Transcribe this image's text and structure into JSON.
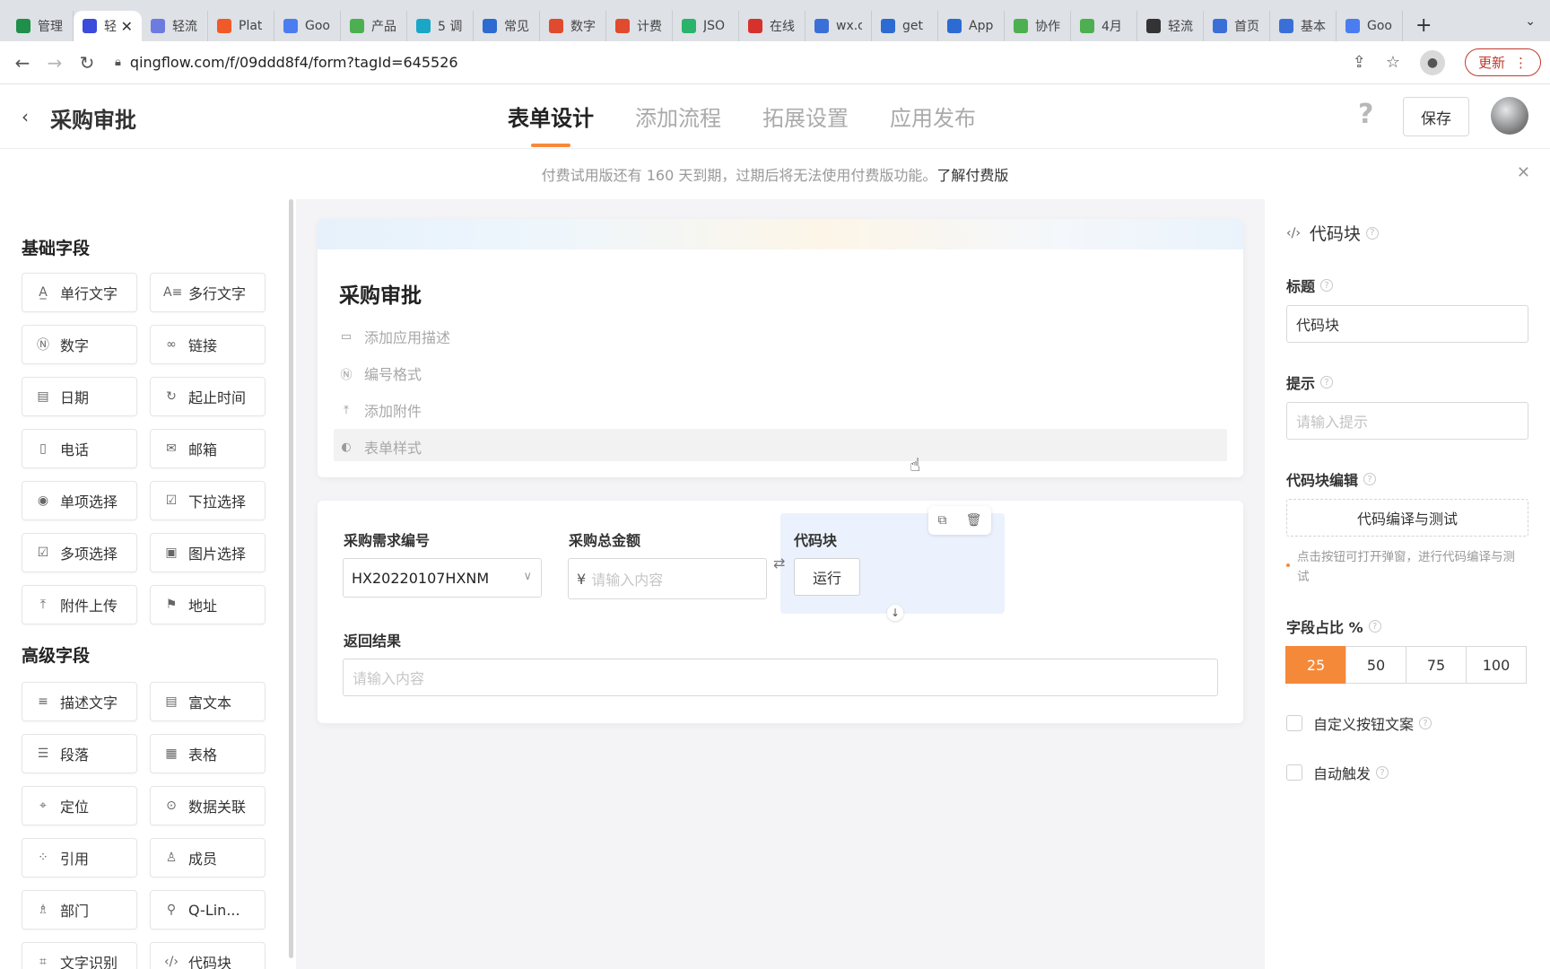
{
  "browser": {
    "tabs": [
      {
        "label": "管理",
        "color": "#1f8f4a"
      },
      {
        "label": "轻",
        "color": "#3b4bdb",
        "active": true
      },
      {
        "label": "轻流",
        "color": "#6b7be0"
      },
      {
        "label": "Plat",
        "color": "#f05a28"
      },
      {
        "label": "Goo",
        "color": "#4a7ef0"
      },
      {
        "label": "产品",
        "color": "#4caf50"
      },
      {
        "label": "5 调",
        "color": "#1aa7c7"
      },
      {
        "label": "常见",
        "color": "#2c6bd1"
      },
      {
        "label": "数字",
        "color": "#e04a2f"
      },
      {
        "label": "计费",
        "color": "#e04a2f"
      },
      {
        "label": "JSO",
        "color": "#29b36b"
      },
      {
        "label": "在线",
        "color": "#d6322b"
      },
      {
        "label": "wx.c",
        "color": "#3a6fd8"
      },
      {
        "label": "get",
        "color": "#2c6bd1"
      },
      {
        "label": "App",
        "color": "#2c6bd1"
      },
      {
        "label": "协作",
        "color": "#4caf50"
      },
      {
        "label": "4月",
        "color": "#4caf50"
      },
      {
        "label": "轻流",
        "color": "#333333"
      },
      {
        "label": "首页",
        "color": "#3a6fd8"
      },
      {
        "label": "基本",
        "color": "#3a6fd8"
      },
      {
        "label": "Goo",
        "color": "#4a7ef0"
      }
    ],
    "active_close": "✕",
    "new_tab": "+",
    "tab_menu": "⌄",
    "url": "qingflow.com/f/09ddd8f4/form?tagId=645526",
    "update_label": "更新",
    "update_menu": "⋮"
  },
  "header": {
    "back": "‹",
    "title": "采购审批",
    "tabs": [
      "表单设计",
      "添加流程",
      "拓展设置",
      "应用发布"
    ],
    "active_tab": 0,
    "help": "?",
    "save_label": "保存"
  },
  "notice": {
    "text": "付费试用版还有 160 天到期，过期后将无法使用付费版功能。",
    "link": "了解付费版",
    "close": "✕"
  },
  "left_panel": {
    "basic_title": "基础字段",
    "basic_fields": [
      {
        "label": "单行文字",
        "icon": "A̲"
      },
      {
        "label": "多行文字",
        "icon": "A≡"
      },
      {
        "label": "数字",
        "icon": "Ⓝ"
      },
      {
        "label": "链接",
        "icon": "∞"
      },
      {
        "label": "日期",
        "icon": "▤"
      },
      {
        "label": "起止时间",
        "icon": "↻"
      },
      {
        "label": "电话",
        "icon": "▯"
      },
      {
        "label": "邮箱",
        "icon": "✉"
      },
      {
        "label": "单项选择",
        "icon": "◉"
      },
      {
        "label": "下拉选择",
        "icon": "☑"
      },
      {
        "label": "多项选择",
        "icon": "☑"
      },
      {
        "label": "图片选择",
        "icon": "▣"
      },
      {
        "label": "附件上传",
        "icon": "⤒"
      },
      {
        "label": "地址",
        "icon": "⚑"
      }
    ],
    "advanced_title": "高级字段",
    "advanced_fields": [
      {
        "label": "描述文字",
        "icon": "≡"
      },
      {
        "label": "富文本",
        "icon": "▤"
      },
      {
        "label": "段落",
        "icon": "☰"
      },
      {
        "label": "表格",
        "icon": "▦"
      },
      {
        "label": "定位",
        "icon": "⌖"
      },
      {
        "label": "数据关联",
        "icon": "⊙"
      },
      {
        "label": "引用",
        "icon": "⁘"
      },
      {
        "label": "成员",
        "icon": "♙"
      },
      {
        "label": "部门",
        "icon": "♗"
      },
      {
        "label": "Q-Lin...",
        "icon": "⚲"
      },
      {
        "label": "文字识别",
        "icon": "⌗"
      },
      {
        "label": "代码块",
        "icon": "‹/›"
      }
    ]
  },
  "form": {
    "title": "采购审批",
    "meta": [
      {
        "label": "添加应用描述",
        "icon": "▭"
      },
      {
        "label": "编号格式",
        "icon": "Ⓝ"
      },
      {
        "label": "添加附件",
        "icon": "⤒"
      },
      {
        "label": "表单样式",
        "icon": "◐"
      }
    ],
    "fields": {
      "req_no_label": "采购需求编号",
      "req_no_value": "HX20220107HXNM",
      "amount_label": "采购总金额",
      "amount_currency": "¥",
      "amount_placeholder": "请输入内容",
      "code_label": "代码块",
      "run_label": "运行",
      "result_label": "返回结果",
      "result_placeholder": "请输入内容"
    }
  },
  "right_panel": {
    "title": "代码块",
    "title_label": "标题",
    "title_value": "代码块",
    "hint_label": "提示",
    "hint_placeholder": "请输入提示",
    "code_edit_label": "代码块编辑",
    "compile_button": "代码编译与测试",
    "compile_hint": "点击按钮可打开弹窗，进行代码编译与测试",
    "ratio_label": "字段占比 %",
    "ratio_options": [
      "25",
      "50",
      "75",
      "100"
    ],
    "ratio_selected": "25",
    "custom_btn_label": "自定义按钮文案",
    "auto_trigger_label": "自动触发"
  },
  "colors": {
    "accent": "#f5893a",
    "code_field_bg": "#ebf2fd"
  }
}
